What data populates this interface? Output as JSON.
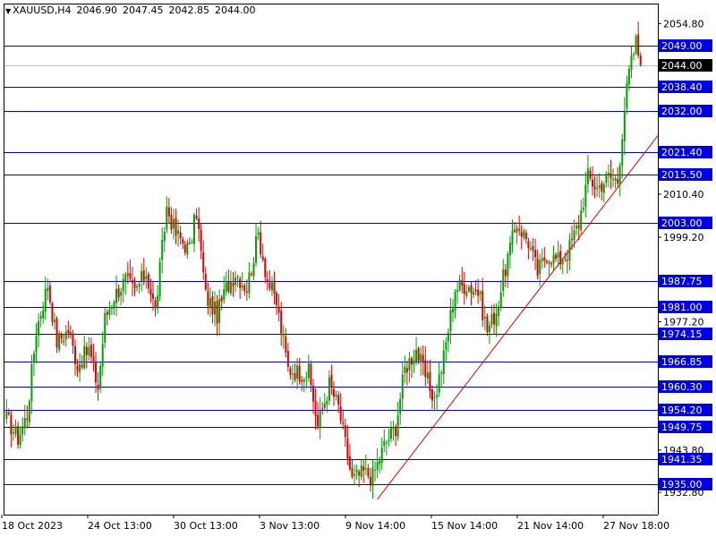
{
  "header": {
    "symbol": "XAUUSD,H4",
    "open": "2046.90",
    "high": "2047.45",
    "low": "2042.85",
    "close": "2044.00"
  },
  "colors": {
    "background": "#ffffff",
    "bull": "#00a000",
    "bear": "#e00000",
    "level_line": "#0000c8",
    "level_label_bg": "#0000e0",
    "current_price_bg": "#000000",
    "trendline": "#e00000",
    "axis": "#000000"
  },
  "chart_data": {
    "type": "candlestick",
    "timeframe": "H4",
    "ylim": [
      1927,
      2060
    ],
    "y_ticks": [
      "2054.80",
      "2010.40",
      "1999.20",
      "1977.20",
      "1943.80",
      "1932.80"
    ],
    "x_ticks": [
      "18 Oct 2023",
      "24 Oct 13:00",
      "30 Oct 13:00",
      "3 Nov 13:00",
      "9 Nov 14:00",
      "15 Nov 14:00",
      "21 Nov 14:00",
      "27 Nov 18:00"
    ],
    "current_price": "2044.00",
    "levels": [
      "2049.00",
      "2038.40",
      "2032.00",
      "2021.40",
      "2015.50",
      "2003.00",
      "1987.75",
      "1981.00",
      "1974.15",
      "1966.85",
      "1960.30",
      "1954.20",
      "1949.75",
      "1941.35",
      "1935.00"
    ],
    "trendline": {
      "from": {
        "bar": 162,
        "price": 1931
      },
      "to": {
        "bar": 274,
        "price": 2017.5
      }
    },
    "waypoints": [
      [
        0,
        1952
      ],
      [
        5,
        1947
      ],
      [
        9,
        1953
      ],
      [
        13,
        1975
      ],
      [
        18,
        1987
      ],
      [
        22,
        1972
      ],
      [
        27,
        1975
      ],
      [
        31,
        1966
      ],
      [
        36,
        1970
      ],
      [
        40,
        1960
      ],
      [
        43,
        1978
      ],
      [
        47,
        1984
      ],
      [
        52,
        1988
      ],
      [
        56,
        1985
      ],
      [
        61,
        1990
      ],
      [
        65,
        1980
      ],
      [
        70,
        2007
      ],
      [
        74,
        2000
      ],
      [
        80,
        1996
      ],
      [
        83,
        2006
      ],
      [
        87,
        1984
      ],
      [
        92,
        1979
      ],
      [
        96,
        1986
      ],
      [
        100,
        1990
      ],
      [
        105,
        1986
      ],
      [
        110,
        2000
      ],
      [
        114,
        1988
      ],
      [
        118,
        1982
      ],
      [
        123,
        1965
      ],
      [
        128,
        1964
      ],
      [
        132,
        1964
      ],
      [
        136,
        1950
      ],
      [
        141,
        1961
      ],
      [
        145,
        1955
      ],
      [
        151,
        1936
      ],
      [
        156,
        1938
      ],
      [
        160,
        1937
      ],
      [
        165,
        1945
      ],
      [
        170,
        1950
      ],
      [
        174,
        1965
      ],
      [
        179,
        1970
      ],
      [
        183,
        1963
      ],
      [
        187,
        1957
      ],
      [
        191,
        1968
      ],
      [
        196,
        1986
      ],
      [
        201,
        1987
      ],
      [
        206,
        1985
      ],
      [
        210,
        1975
      ],
      [
        214,
        1980
      ],
      [
        219,
        1994
      ],
      [
        223,
        2003
      ],
      [
        228,
        1998
      ],
      [
        232,
        1990
      ],
      [
        236,
        1995
      ],
      [
        241,
        1993
      ],
      [
        245,
        1995
      ],
      [
        250,
        2003
      ],
      [
        254,
        2015
      ],
      [
        258,
        2012
      ],
      [
        263,
        2015
      ],
      [
        267,
        2014
      ],
      [
        270,
        2033
      ],
      [
        272,
        2042
      ],
      [
        275,
        2050
      ],
      [
        277,
        2044
      ]
    ]
  }
}
